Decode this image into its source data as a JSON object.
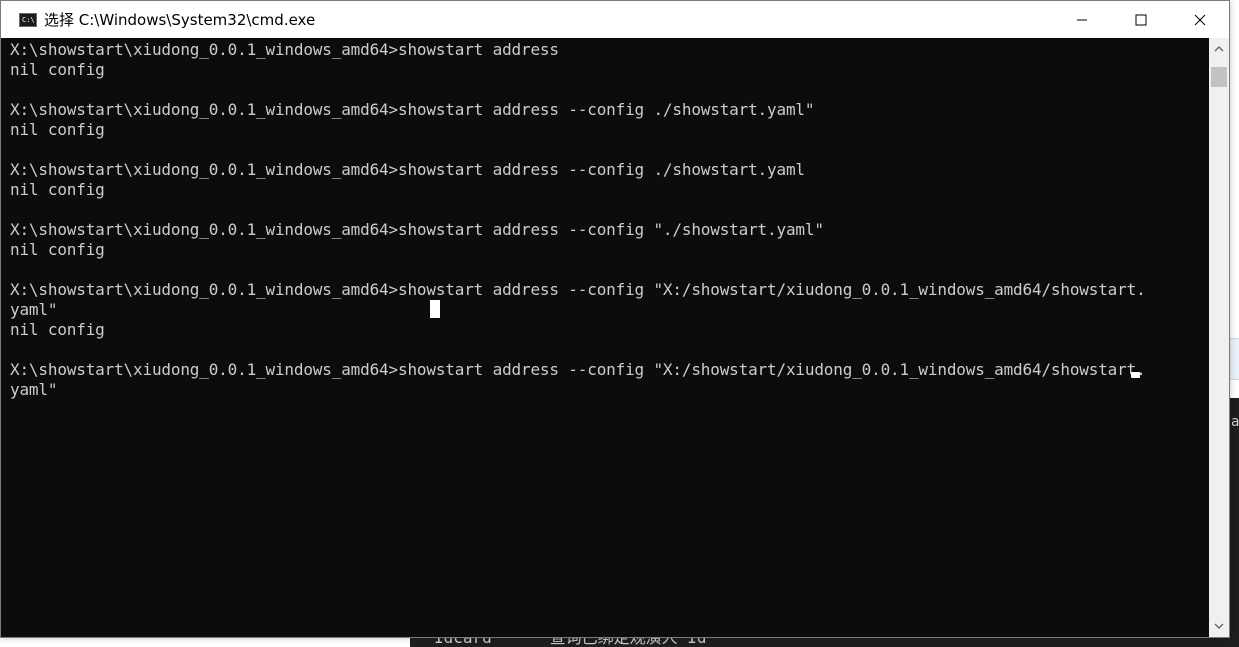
{
  "window": {
    "title": "选择 C:\\Windows\\System32\\cmd.exe",
    "controls": {
      "minimize": "minimize-icon",
      "maximize": "maximize-icon",
      "close": "close-icon"
    }
  },
  "console": {
    "lines": [
      "X:\\showstart\\xiudong_0.0.1_windows_amd64>showstart address",
      "nil config",
      "",
      "X:\\showstart\\xiudong_0.0.1_windows_amd64>showstart address --config ./showstart.yaml\"",
      "nil config",
      "",
      "X:\\showstart\\xiudong_0.0.1_windows_amd64>showstart address --config ./showstart.yaml",
      "nil config",
      "",
      "X:\\showstart\\xiudong_0.0.1_windows_amd64>showstart address --config \"./showstart.yaml\"",
      "nil config",
      "",
      "X:\\showstart\\xiudong_0.0.1_windows_amd64>showstart address --config \"X:/showstart/xiudong_0.0.1_windows_amd64/showstart.",
      "yaml\"",
      "nil config",
      "",
      "X:\\showstart\\xiudong_0.0.1_windows_amd64>showstart address --config \"X:/showstart/xiudong_0.0.1_windows_amd64/showstart.",
      "yaml\""
    ]
  },
  "background": {
    "bottom_text": "Idcard      查询已绑定观演人 Id"
  },
  "colors": {
    "console_bg": "#0c0c0c",
    "console_fg": "#cccccc",
    "titlebar_bg": "#ffffff"
  }
}
